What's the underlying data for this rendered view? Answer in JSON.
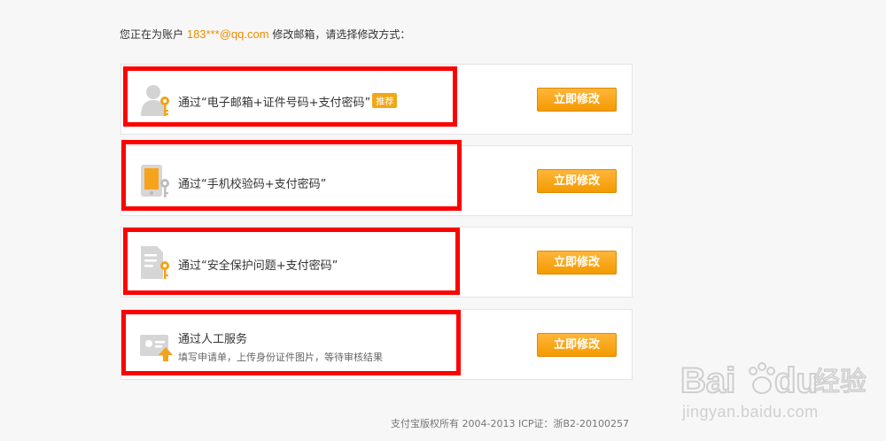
{
  "intro": {
    "prefix": "您正在为账户",
    "account": "183***@qq.com",
    "suffix": "修改邮箱，请选择修改方式："
  },
  "options": [
    {
      "icon": "person-key-icon",
      "label": "通过“电子邮箱+证件号码+支付密码”",
      "badge": "推荐",
      "button": "立即修改"
    },
    {
      "icon": "phone-key-icon",
      "label": "通过“手机校验码+支付密码”",
      "button": "立即修改"
    },
    {
      "icon": "document-key-icon",
      "label": "通过“安全保护问题+支付密码”",
      "button": "立即修改"
    },
    {
      "icon": "id-card-upload-icon",
      "label": "通过人工服务",
      "sublabel": "填写申请单，上传身份证件图片，等待审核结果",
      "button": "立即修改"
    }
  ],
  "footer": "支付宝版权所有 2004-2013 ICP证：浙B2-20100257",
  "watermark": {
    "logo_text": "Baidu经验",
    "url": "jingyan.baidu.com"
  },
  "colors": {
    "accent": "#f08c00",
    "button": "#f39a00",
    "highlight": "#ff0000"
  }
}
